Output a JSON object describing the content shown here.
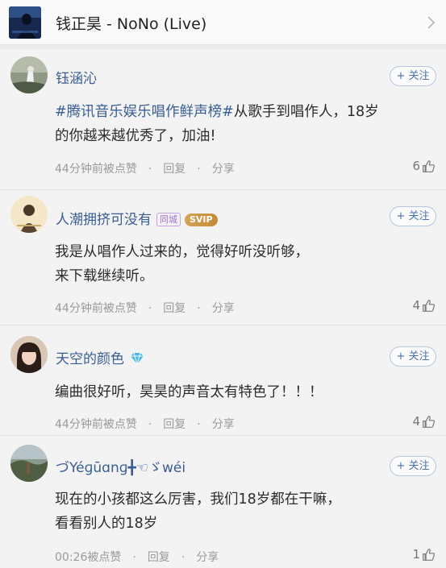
{
  "header": {
    "song_title": "钱正昊 - NoNo (Live)"
  },
  "actions": {
    "follow_label": "+ 关注",
    "reply_label": "回复",
    "share_label": "分享",
    "separator": "·"
  },
  "comments": [
    {
      "username": "钰涵沁",
      "hashtag": "#腾讯音乐娱乐唱作鲜声榜#",
      "text_line1": "从歌手到唱作人，18岁",
      "text_line2": "的你越来越优秀了，加油!",
      "time": "44分钟前被点赞",
      "likes": "6"
    },
    {
      "username": "人潮拥挤可没有",
      "badge_local": "同城",
      "badge_vip": "SVIP",
      "text_line1": "我是从唱作人过来的，觉得好听没听够，",
      "text_line2": "来下载继续听。",
      "time": "44分钟前被点赞",
      "likes": "4"
    },
    {
      "username": "天空的颜色",
      "text_line1": "编曲很好听，昊昊的声音太有特色了！！！",
      "time": "44分钟前被点赞",
      "likes": "4"
    },
    {
      "username": "づYéɡūɑnɡ╋☜ゞwéi",
      "text_line1": "现在的小孩都这么厉害，我们18岁都在干嘛，",
      "text_line2": "看看别人的18岁",
      "time": "00:26被点赞",
      "likes": "1"
    }
  ],
  "colors": {
    "username": "#3a5e93",
    "follow_border": "#b5c6de",
    "meta_text": "#9a9a9a",
    "background": "#f3f3f3"
  }
}
